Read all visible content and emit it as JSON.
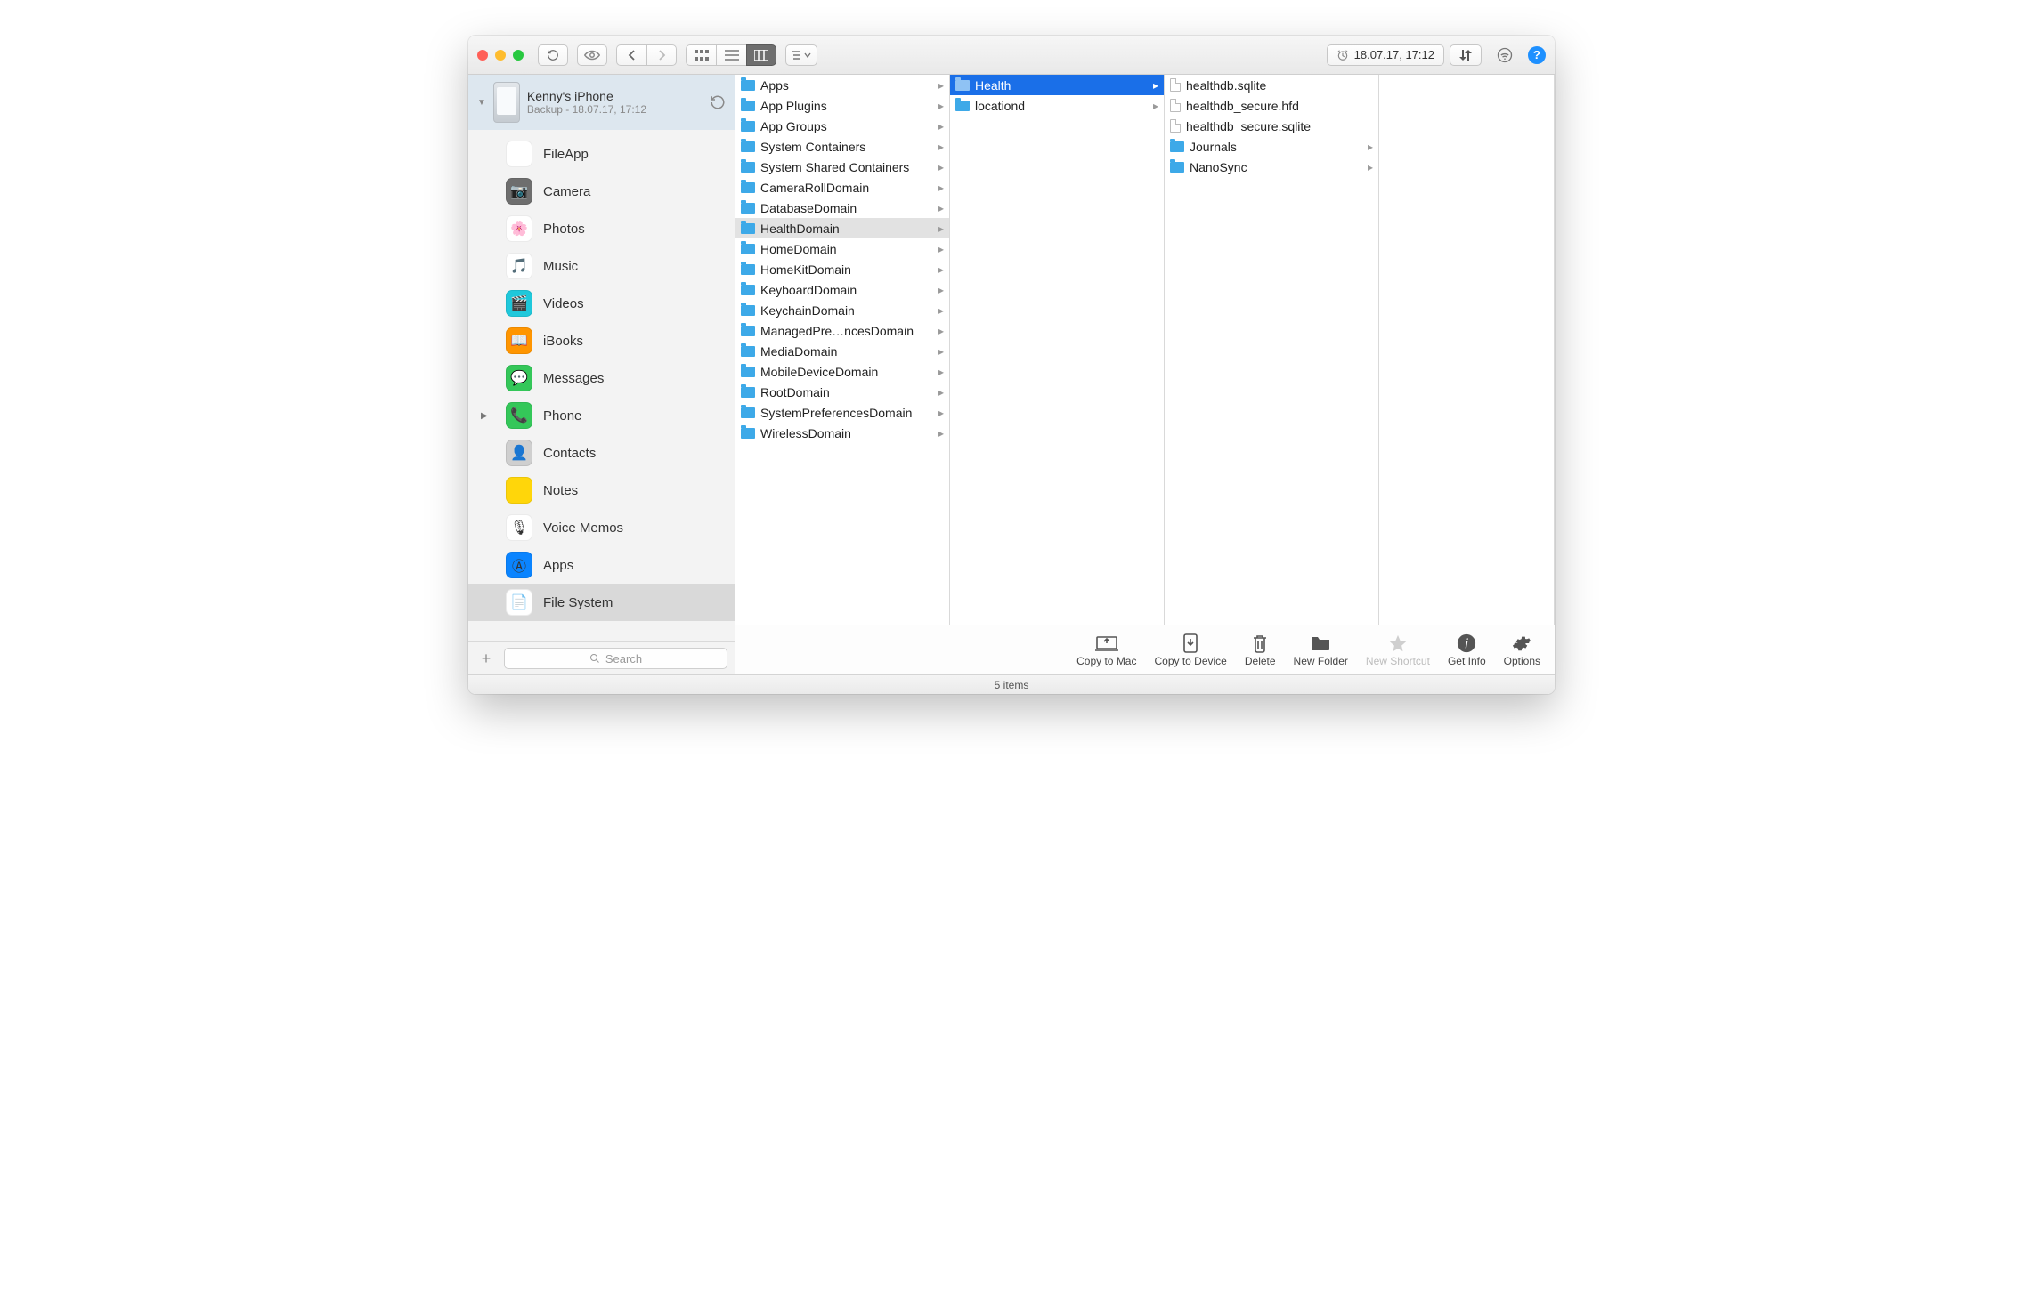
{
  "toolbar": {
    "timestamp": "18.07.17, 17:12"
  },
  "device": {
    "name": "Kenny's iPhone",
    "subtitle": "Backup - 18.07.17, 17:12"
  },
  "sidebar": {
    "items": [
      {
        "label": "FileApp",
        "color": "#ffffff",
        "emoji": "",
        "hasArrow": false
      },
      {
        "label": "Camera",
        "color": "#6e6e6e",
        "emoji": "📷",
        "hasArrow": false
      },
      {
        "label": "Photos",
        "color": "#ffffff",
        "emoji": "🌸",
        "hasArrow": false
      },
      {
        "label": "Music",
        "color": "#ffffff",
        "emoji": "🎵",
        "hasArrow": false
      },
      {
        "label": "Videos",
        "color": "#1fc8db",
        "emoji": "🎬",
        "hasArrow": false
      },
      {
        "label": "iBooks",
        "color": "#ff9500",
        "emoji": "📖",
        "hasArrow": false
      },
      {
        "label": "Messages",
        "color": "#34c759",
        "emoji": "💬",
        "hasArrow": false
      },
      {
        "label": "Phone",
        "color": "#34c759",
        "emoji": "📞",
        "hasArrow": true
      },
      {
        "label": "Contacts",
        "color": "#cfcfcf",
        "emoji": "👤",
        "hasArrow": false
      },
      {
        "label": "Notes",
        "color": "#ffd60a",
        "emoji": "",
        "hasArrow": false
      },
      {
        "label": "Voice Memos",
        "color": "#ffffff",
        "emoji": "🎙",
        "hasArrow": false
      },
      {
        "label": "Apps",
        "color": "#0a84ff",
        "emoji": "Ⓐ",
        "hasArrow": false
      },
      {
        "label": "File System",
        "color": "#ffffff",
        "emoji": "📄",
        "hasArrow": false,
        "selected": true
      }
    ],
    "search_placeholder": "Search"
  },
  "columns": {
    "col1": [
      {
        "label": "Apps",
        "folder": true,
        "chev": true
      },
      {
        "label": "App Plugins",
        "folder": true,
        "chev": true
      },
      {
        "label": "App Groups",
        "folder": true,
        "chev": true
      },
      {
        "label": "System Containers",
        "folder": true,
        "chev": true
      },
      {
        "label": "System Shared Containers",
        "folder": true,
        "chev": true
      },
      {
        "label": "CameraRollDomain",
        "folder": true,
        "chev": true
      },
      {
        "label": "DatabaseDomain",
        "folder": true,
        "chev": true
      },
      {
        "label": "HealthDomain",
        "folder": true,
        "chev": true,
        "selected": "grey"
      },
      {
        "label": "HomeDomain",
        "folder": true,
        "chev": true
      },
      {
        "label": "HomeKitDomain",
        "folder": true,
        "chev": true
      },
      {
        "label": "KeyboardDomain",
        "folder": true,
        "chev": true
      },
      {
        "label": "KeychainDomain",
        "folder": true,
        "chev": true
      },
      {
        "label": "ManagedPre…ncesDomain",
        "folder": true,
        "chev": true
      },
      {
        "label": "MediaDomain",
        "folder": true,
        "chev": true
      },
      {
        "label": "MobileDeviceDomain",
        "folder": true,
        "chev": true
      },
      {
        "label": "RootDomain",
        "folder": true,
        "chev": true
      },
      {
        "label": "SystemPreferencesDomain",
        "folder": true,
        "chev": true
      },
      {
        "label": "WirelessDomain",
        "folder": true,
        "chev": true
      }
    ],
    "col2": [
      {
        "label": "Health",
        "folder": true,
        "chev": true,
        "selected": "blue"
      },
      {
        "label": "locationd",
        "folder": true,
        "chev": true
      }
    ],
    "col3": [
      {
        "label": "healthdb.sqlite",
        "folder": false,
        "chev": false
      },
      {
        "label": "healthdb_secure.hfd",
        "folder": false,
        "chev": false
      },
      {
        "label": "healthdb_secure.sqlite",
        "folder": false,
        "chev": false
      },
      {
        "label": "Journals",
        "folder": true,
        "chev": true
      },
      {
        "label": "NanoSync",
        "folder": true,
        "chev": true
      }
    ]
  },
  "actions": {
    "copy_to_mac": "Copy to Mac",
    "copy_to_device": "Copy to Device",
    "delete": "Delete",
    "new_folder": "New Folder",
    "new_shortcut": "New Shortcut",
    "get_info": "Get Info",
    "options": "Options"
  },
  "status": "5 items"
}
